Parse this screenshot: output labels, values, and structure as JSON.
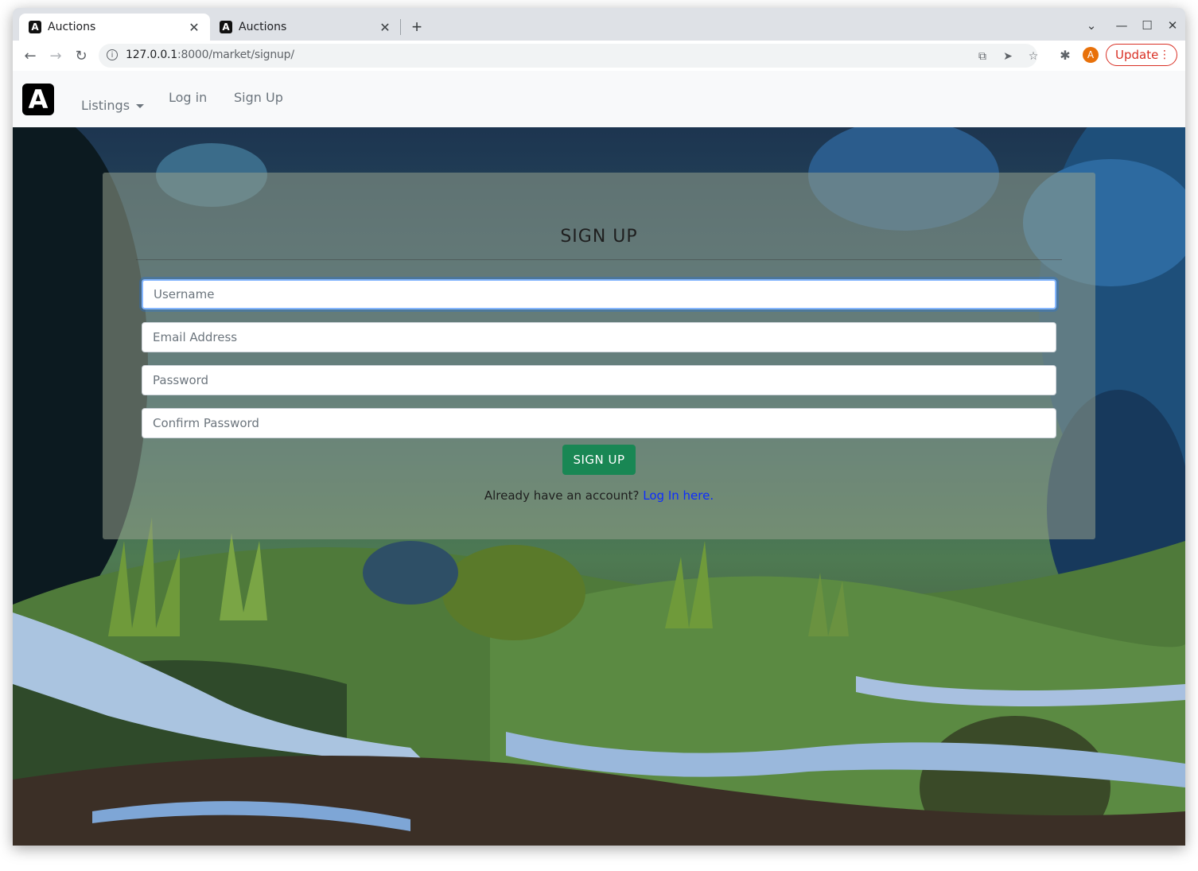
{
  "browser": {
    "tabs": [
      {
        "title": "Auctions",
        "favicon": "A"
      },
      {
        "title": "Auctions",
        "favicon": "A"
      }
    ],
    "url_host": "127.0.0.1",
    "url_rest": ":8000/market/signup/",
    "update_label": "Update",
    "profile_initial": "A"
  },
  "site": {
    "logo": "A",
    "nav": {
      "listings": "Listings",
      "login": "Log in",
      "signup": "Sign Up"
    }
  },
  "form": {
    "title": "SIGN UP",
    "username_placeholder": "Username",
    "email_placeholder": "Email Address",
    "password_placeholder": "Password",
    "confirm_placeholder": "Confirm Password",
    "submit_label": "SIGN UP",
    "footer_prefix": "Already have an account?",
    "footer_link": "Log In here."
  },
  "colors": {
    "accent_green": "#198754",
    "link_blue": "#0d2cff",
    "update_red": "#d93025"
  }
}
